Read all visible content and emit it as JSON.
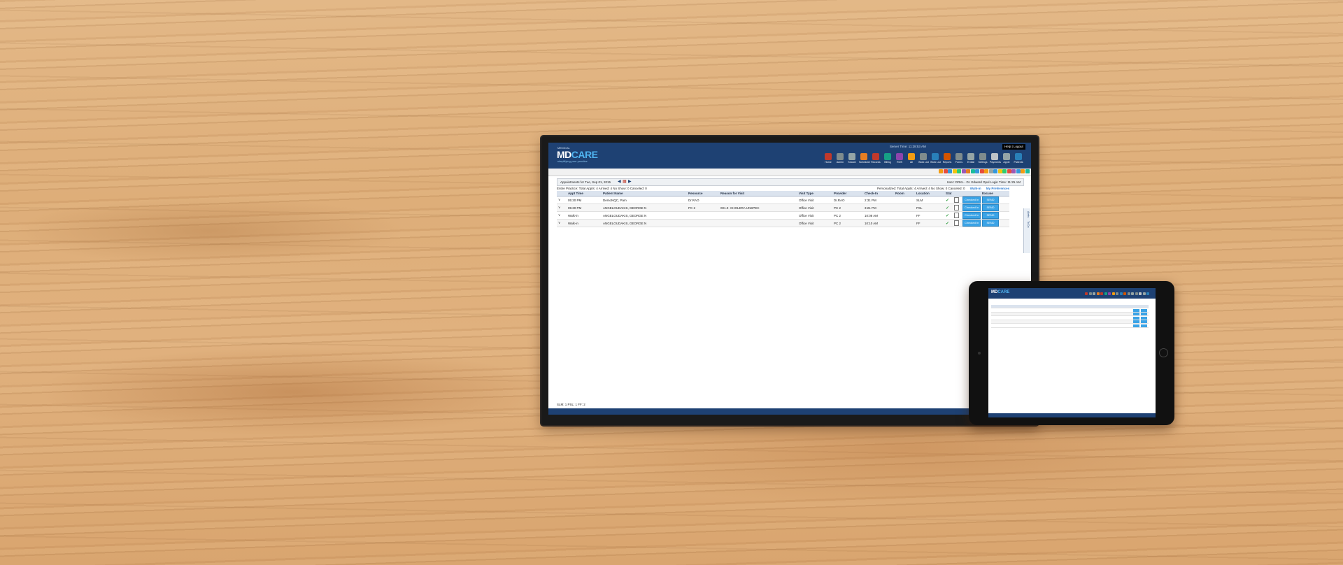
{
  "app": {
    "brand_small": "MEDICAL",
    "brand_md": "MD",
    "brand_care": "CARE",
    "tagline": "simplifying your practice",
    "server_time": "Server Time: 11:28:53 AM",
    "help": "Help",
    "logout": "Logout"
  },
  "toolbar": [
    {
      "label": "Home",
      "icon": "home-icon",
      "color": "#c0392b"
    },
    {
      "label": "Admin",
      "icon": "admin-icon",
      "color": "#7f8c8d"
    },
    {
      "label": "Search",
      "icon": "search-icon",
      "color": "#95a5a6"
    },
    {
      "label": "Scheduler",
      "icon": "calendar-icon",
      "color": "#e67e22"
    },
    {
      "label": "Records",
      "icon": "records-icon",
      "color": "#c0392b"
    },
    {
      "label": "Billing",
      "icon": "dollar-icon",
      "color": "#16a085"
    },
    {
      "label": "ROS",
      "icon": "ros-icon",
      "color": "#8e44ad"
    },
    {
      "label": "All",
      "icon": "all-icon",
      "color": "#f39c12"
    },
    {
      "label": "Work List",
      "icon": "worklist-icon",
      "color": "#7f8c8d"
    },
    {
      "label": "Work List",
      "icon": "worklist2-icon",
      "color": "#2980b9"
    },
    {
      "label": "Reports",
      "icon": "reports-icon",
      "color": "#d35400"
    },
    {
      "label": "Forms",
      "icon": "forms-icon",
      "color": "#7f8c8d"
    },
    {
      "label": "E Mail",
      "icon": "email-icon",
      "color": "#95a5a6"
    },
    {
      "label": "Settings",
      "icon": "settings-icon",
      "color": "#7f8c8d"
    },
    {
      "label": "Payments",
      "icon": "payments-icon",
      "color": "#bdc3c7"
    },
    {
      "label": "Apple",
      "icon": "apple-icon",
      "color": "#95a5a6"
    },
    {
      "label": "Patients",
      "icon": "patients-icon",
      "color": "#2980b9"
    }
  ],
  "appointments": {
    "title": "Appointments for Tue, Sep 01, 2015",
    "user_info": "User: DRKL - Dr. Edward Opol   Login Time: 11:25 AM",
    "stats_left": "Entire Practice:  Total Appts: 4    Arrived: 4    No Show: 0    Canceled: 0",
    "stats_right": "Personalized: Total Appts: 4    Arrived: 4    No Show: 0    Canceled: 0",
    "walk_in": "Walk-in",
    "my_preferences": "My Preferences",
    "columns": [
      "",
      "Appt Time",
      "Patient Name",
      "Resource",
      "Reason for Visit",
      "Visit Type",
      "Provider",
      "Check-In",
      "Room",
      "Location",
      "Stat",
      "",
      "",
      "Excuse"
    ],
    "rows": [
      {
        "time": "05:30 PM",
        "patient": "DemoNQC, Pam",
        "resource": "Dr.RAO",
        "reason": "",
        "type": "Office Visit",
        "provider": "Dr.RAO",
        "checkin": "2:31 PM",
        "room": "",
        "location": "SLM",
        "action": "Checked In",
        "excuse": "SEND"
      },
      {
        "time": "05:30 PM",
        "patient": "ANGELOUDAKIS, GEORGE N",
        "resource": "PC 2",
        "reason": "001.0- CHOLERA UNSPEC",
        "type": "Office Visit",
        "provider": "PC 2",
        "checkin": "3:21 PM",
        "room": "",
        "location": "PSL",
        "action": "Checked In",
        "excuse": "SEND"
      },
      {
        "time": "Walk-in",
        "patient": "ANGELOUDAKIS, GEORGE N",
        "resource": "",
        "reason": "",
        "type": "Office Visit",
        "provider": "PC 2",
        "checkin": "10:08 AM",
        "room": "",
        "location": "FF",
        "action": "Checked In",
        "excuse": "SEND"
      },
      {
        "time": "Walk-in",
        "patient": "ANGELOUDAKIS, GEORGE N",
        "resource": "",
        "reason": "",
        "type": "Office Visit",
        "provider": "PC 2",
        "checkin": "10:10 AM",
        "room": "",
        "location": "FF",
        "action": "Checked In",
        "excuse": "SEND"
      }
    ],
    "footer": "SLM: 1    PSL: 1    FF: 2",
    "side_tab_1": "Alerts",
    "side_tab_2": "To Do"
  },
  "colors": {
    "header": "#1e4173",
    "accent": "#3aa3e6",
    "check": "#2b9a3b"
  }
}
